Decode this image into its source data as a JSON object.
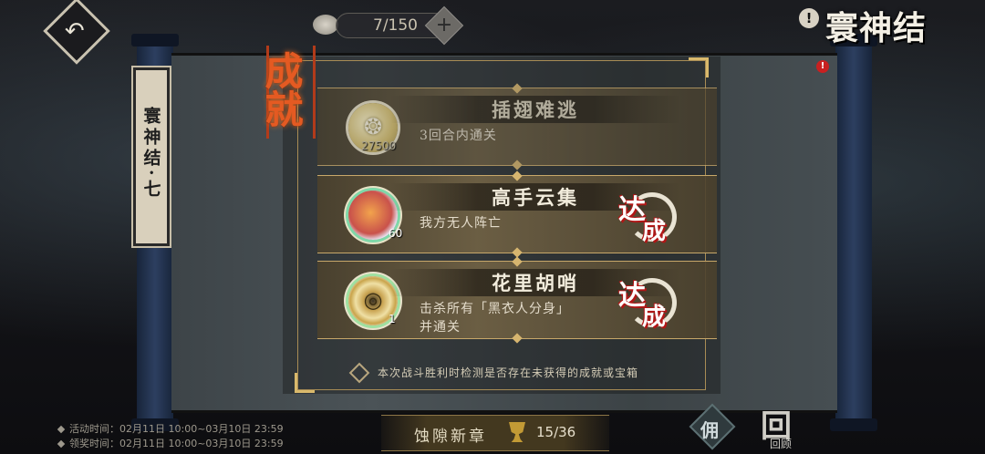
{
  "header": {
    "back_icon": "back-arrow-icon",
    "counter": "7/150",
    "coin_icon": "coin-icon",
    "plus_label": "+",
    "info_label": "!",
    "event_title": "寰神结"
  },
  "chapter_tag": "寰神结·七",
  "notification_badge": "!",
  "dialog": {
    "seal_text": "成就",
    "achievements": [
      {
        "title": "插翅难逃",
        "description": "3回合内通关",
        "reward_icon": "coin-icon",
        "reward_count": "27500",
        "completed": false
      },
      {
        "title": "高手云集",
        "description": "我方无人阵亡",
        "reward_icon": "food-icon",
        "reward_count": "60",
        "completed": true,
        "stamp_a": "达",
        "stamp_b": "成"
      },
      {
        "title": "花里胡哨",
        "description_line1": "击杀所有「黑衣人分身」",
        "description_line2": "并通关",
        "reward_icon": "medal-icon",
        "reward_count": "1",
        "completed": true,
        "stamp_a": "达",
        "stamp_b": "成"
      }
    ],
    "footer_note": "本次战斗胜利时检测是否存在未获得的成就或宝箱"
  },
  "bottom": {
    "activity_time": "活动时间：02月11日 10:00~03月10日 23:59",
    "claim_time": "领奖时间：02月11日 10:00~03月10日 23:59",
    "progress_label": "蚀隙新章",
    "progress_value": "15/36",
    "menu_label": "佣",
    "review_big": "回",
    "review_small": "回顾"
  },
  "colors": {
    "accent_gold": "#d6b56f",
    "stamp_red": "#b01616",
    "seal_orange": "#e45a22"
  }
}
